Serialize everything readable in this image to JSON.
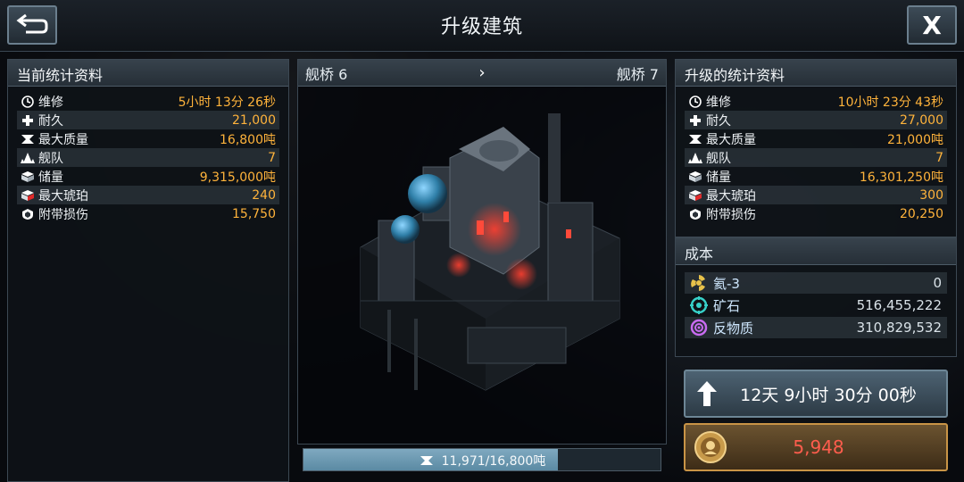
{
  "header": {
    "title": "升级建筑",
    "close_label": "X"
  },
  "current_stats": {
    "title": "当前统计资料",
    "rows": [
      {
        "icon": "clock-icon",
        "label": "维修",
        "value": "5小时 13分 26秒"
      },
      {
        "icon": "plus-icon",
        "label": "耐久",
        "value": "21,000"
      },
      {
        "icon": "weight-icon",
        "label": "最大质量",
        "value": "16,800吨"
      },
      {
        "icon": "fleet-icon",
        "label": "舰队",
        "value": "7"
      },
      {
        "icon": "storage-icon",
        "label": "储量",
        "value": "9,315,000吨"
      },
      {
        "icon": "amber-icon",
        "label": "最大琥珀",
        "value": "240"
      },
      {
        "icon": "shield-icon",
        "label": "附带损伤",
        "value": "15,750"
      }
    ]
  },
  "building": {
    "from_label": "舰桥 6",
    "to_label": "舰桥 7",
    "capacity": {
      "text": "11,971/16,800吨",
      "fraction": 0.7126
    }
  },
  "upgraded_stats": {
    "title": "升级的统计资料",
    "rows": [
      {
        "icon": "clock-icon",
        "label": "维修",
        "value": "10小时 23分 43秒"
      },
      {
        "icon": "plus-icon",
        "label": "耐久",
        "value": "27,000"
      },
      {
        "icon": "weight-icon",
        "label": "最大质量",
        "value": "21,000吨"
      },
      {
        "icon": "fleet-icon",
        "label": "舰队",
        "value": "7"
      },
      {
        "icon": "storage-icon",
        "label": "储量",
        "value": "16,301,250吨"
      },
      {
        "icon": "amber-icon",
        "label": "最大琥珀",
        "value": "300"
      },
      {
        "icon": "shield-icon",
        "label": "附带损伤",
        "value": "20,250"
      }
    ]
  },
  "cost": {
    "title": "成本",
    "items": [
      {
        "icon": "helium-icon",
        "label": "氦-3",
        "value": "0",
        "color": "#e8c24a"
      },
      {
        "icon": "ore-icon",
        "label": "矿石",
        "value": "516,455,222",
        "color": "#37d0c8"
      },
      {
        "icon": "antimatter-icon",
        "label": "反物质",
        "value": "310,829,532",
        "color": "#c86bf0"
      }
    ]
  },
  "upgrade": {
    "time_label": "12天 9小时 30分 00秒"
  },
  "instant": {
    "price": "5,948",
    "price_color": "#ff5d4d"
  }
}
